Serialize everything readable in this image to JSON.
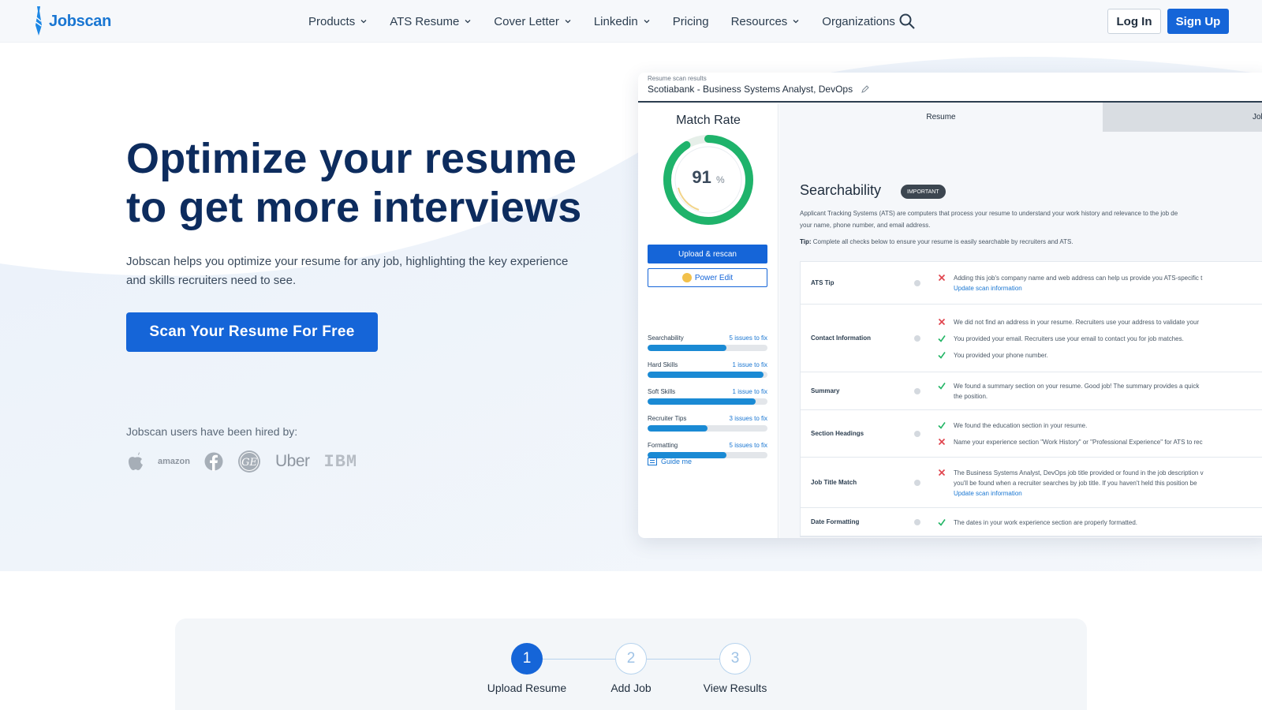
{
  "nav": {
    "brand": "Jobscan",
    "links": [
      {
        "label": "Products",
        "dropdown": true
      },
      {
        "label": "ATS Resume",
        "dropdown": true
      },
      {
        "label": "Cover Letter",
        "dropdown": true
      },
      {
        "label": "Linkedin",
        "dropdown": true
      },
      {
        "label": "Pricing",
        "dropdown": false
      },
      {
        "label": "Resources",
        "dropdown": true
      },
      {
        "label": "Organizations",
        "dropdown": false
      }
    ],
    "login": "Log In",
    "signup": "Sign Up"
  },
  "hero": {
    "title_line1": "Optimize your resume",
    "title_line2": "to get more interviews",
    "subtitle_line1": "Jobscan helps you optimize your resume for any job, highlighting the key experience",
    "subtitle_line2": "and skills recruiters need to see.",
    "cta": "Scan Your Resume For Free",
    "hired_by": "Jobscan users have been hired by:",
    "companies": [
      "apple-logo",
      "amazon",
      "facebook-logo",
      "ge-logo",
      "Uber",
      "IBM"
    ],
    "amazon_text": "amazon",
    "uber_text": "Uber",
    "ibm_text": "IBM"
  },
  "preview": {
    "head_small": "Resume scan results",
    "head_title": "Scotiabank - Business Systems Analyst, DevOps",
    "match_rate_title": "Match Rate",
    "match_rate": 91,
    "match_rate_unit": "%",
    "upload_btn": "Upload & rescan",
    "power_btn": "Power Edit",
    "metrics": [
      {
        "name": "Searchability",
        "issues": "5 issues to fix",
        "fill": 0.66
      },
      {
        "name": "Hard Skills",
        "issues": "1 issue to fix",
        "fill": 0.97
      },
      {
        "name": "Soft Skills",
        "issues": "1 issue to fix",
        "fill": 0.9
      },
      {
        "name": "Recruiter Tips",
        "issues": "3 issues to fix",
        "fill": 0.5
      },
      {
        "name": "Formatting",
        "issues": "5 issues to fix",
        "fill": 0.66
      }
    ],
    "guide": "Guide me",
    "tab_resume": "Resume",
    "tab_job": "Job",
    "section_title": "Searchability",
    "badge": "IMPORTANT",
    "desc_line1": "Applicant Tracking Systems (ATS) are computers that process your resume to understand your work history and relevance to the job de",
    "desc_line2": "your name, phone number, and email address.",
    "tip_label": "Tip:",
    "tip_text": " Complete all checks below to ensure your resume is easily searchable by recruiters and ATS.",
    "checks": [
      {
        "label": "ATS Tip",
        "items": [
          {
            "status": "fail",
            "text": "Adding this job's company name and web address can help us provide you ATS-specific t",
            "link": "Update scan information"
          }
        ]
      },
      {
        "label": "Contact Information",
        "items": [
          {
            "status": "fail",
            "text": "We did not find an address in your resume. Recruiters use your address to validate your"
          },
          {
            "status": "pass",
            "text": "You provided your email. Recruiters use your email to contact you for job matches."
          },
          {
            "status": "pass",
            "text": "You provided your phone number."
          }
        ]
      },
      {
        "label": "Summary",
        "items": [
          {
            "status": "pass",
            "text": "We found a summary section on your resume. Good job! The summary provides a quick",
            "text2": "the position."
          }
        ]
      },
      {
        "label": "Section Headings",
        "items": [
          {
            "status": "pass",
            "text": "We found the education section in your resume."
          },
          {
            "status": "fail",
            "text": "Name your experience section \"Work History\" or \"Professional Experience\" for ATS to rec"
          }
        ]
      },
      {
        "label": "Job Title Match",
        "items": [
          {
            "status": "fail",
            "text": "The Business Systems Analyst, DevOps job title provided or found in the job description v",
            "text2": "you'll be found when a recruiter searches by job title. If you haven't held this position be",
            "link": "Update scan information"
          }
        ]
      },
      {
        "label": "Date Formatting",
        "items": [
          {
            "status": "pass",
            "text": "The dates in your work experience section are properly formatted."
          }
        ]
      }
    ]
  },
  "steps": [
    {
      "num": "1",
      "label": "Upload Resume",
      "active": true
    },
    {
      "num": "2",
      "label": "Add Job",
      "active": false
    },
    {
      "num": "3",
      "label": "View Results",
      "active": false
    }
  ],
  "colors": {
    "brand_blue": "#1565d8",
    "navy": "#0d2c5e",
    "gauge_green": "#1fb36b",
    "fail_red": "#e0424b",
    "pass_green": "#22b565"
  }
}
